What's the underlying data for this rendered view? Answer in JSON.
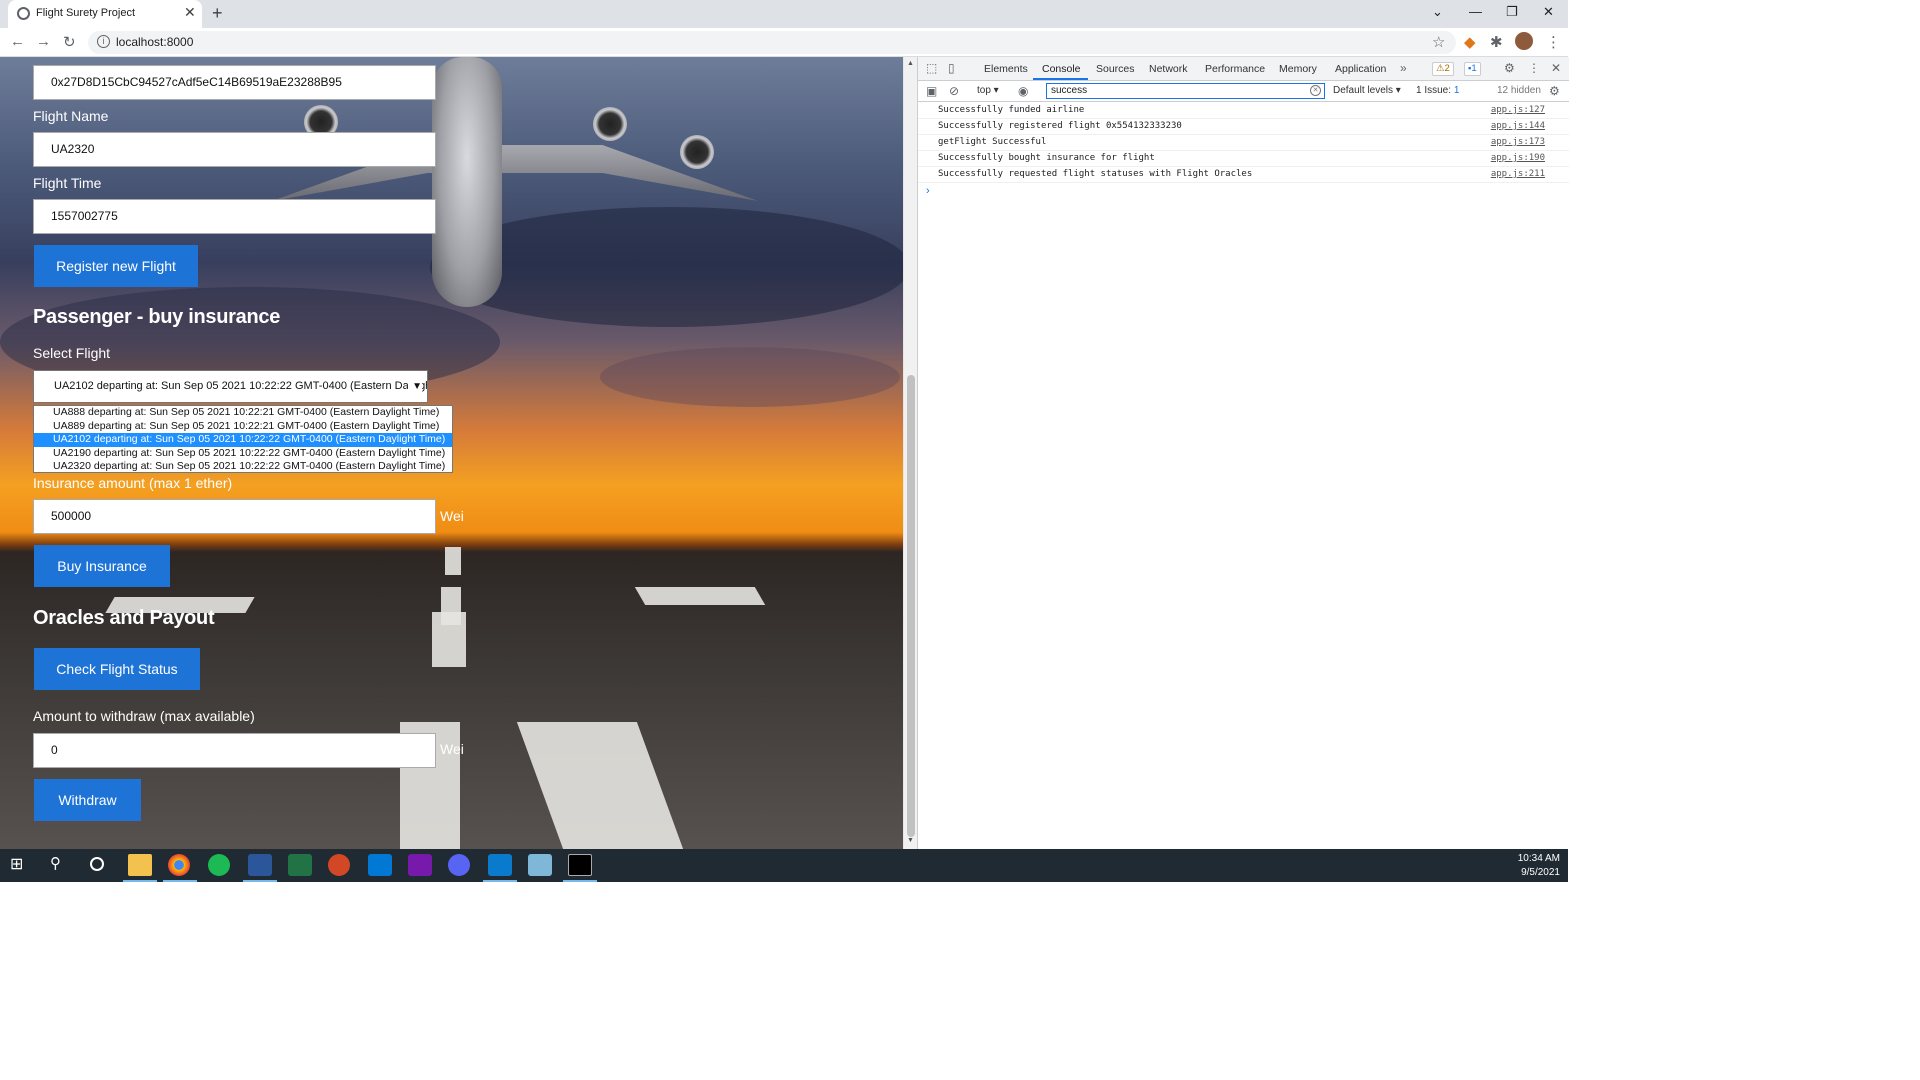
{
  "browser": {
    "tab_title": "Flight Surety Project",
    "url": "localhost:8000"
  },
  "page": {
    "airline_address_value": "0x27D8D15CbC94527cAdf5eC14B69519aE23288B95",
    "flight_name_label": "Flight Name",
    "flight_name_value": "UA2320",
    "flight_time_label": "Flight Time",
    "flight_time_value": "1557002775",
    "register_button": "Register new Flight",
    "passenger_title": "Passenger - buy insurance",
    "select_flight_label": "Select Flight",
    "selected_flight": "UA2102 departing at: Sun Sep 05 2021 10:22:22 GMT-0400 (Eastern Daylight Time)",
    "flight_options": [
      "UA888 departing at: Sun Sep 05 2021 10:22:21 GMT-0400 (Eastern Daylight Time)",
      "UA889 departing at: Sun Sep 05 2021 10:22:21 GMT-0400 (Eastern Daylight Time)",
      "UA2102 departing at: Sun Sep 05 2021 10:22:22 GMT-0400 (Eastern Daylight Time)",
      "UA2190 departing at: Sun Sep 05 2021 10:22:22 GMT-0400 (Eastern Daylight Time)",
      "UA2320 departing at: Sun Sep 05 2021 10:22:22 GMT-0400 (Eastern Daylight Time)"
    ],
    "insurance_label": "Insurance amount (max 1 ether)",
    "insurance_value": "500000",
    "unit": "Wei",
    "buy_button": "Buy Insurance",
    "oracles_title": "Oracles and Payout",
    "check_button": "Check Flight Status",
    "withdraw_label": "Amount to withdraw (max available)",
    "withdraw_value": "0",
    "withdraw_button": "Withdraw"
  },
  "devtools": {
    "tabs": [
      "Elements",
      "Console",
      "Sources",
      "Network",
      "Performance",
      "Memory",
      "Application"
    ],
    "active_tab": "Console",
    "warnings_count": "2",
    "messages_count": "1",
    "context": "top",
    "filter_value": "success",
    "levels": "Default levels",
    "issues": "1 Issue:",
    "issues_count": "1",
    "hidden": "12 hidden",
    "logs": [
      {
        "msg": "Successfully funded airline",
        "src": "app.js:127"
      },
      {
        "msg": "Successfully registered flight 0x554132333230",
        "src": "app.js:144"
      },
      {
        "msg": "getFlight Successful",
        "src": "app.js:173"
      },
      {
        "msg": "Successfully bought insurance for flight",
        "src": "app.js:190"
      },
      {
        "msg": "Successfully requested flight statuses with Flight Oracles",
        "src": "app.js:211"
      }
    ]
  },
  "taskbar": {
    "time": "10:34 AM",
    "date": "9/5/2021"
  },
  "colors": {
    "button_blue": "#1d73d6",
    "devtools_accent": "#1a73e8",
    "taskbar": "#1f2a33"
  }
}
